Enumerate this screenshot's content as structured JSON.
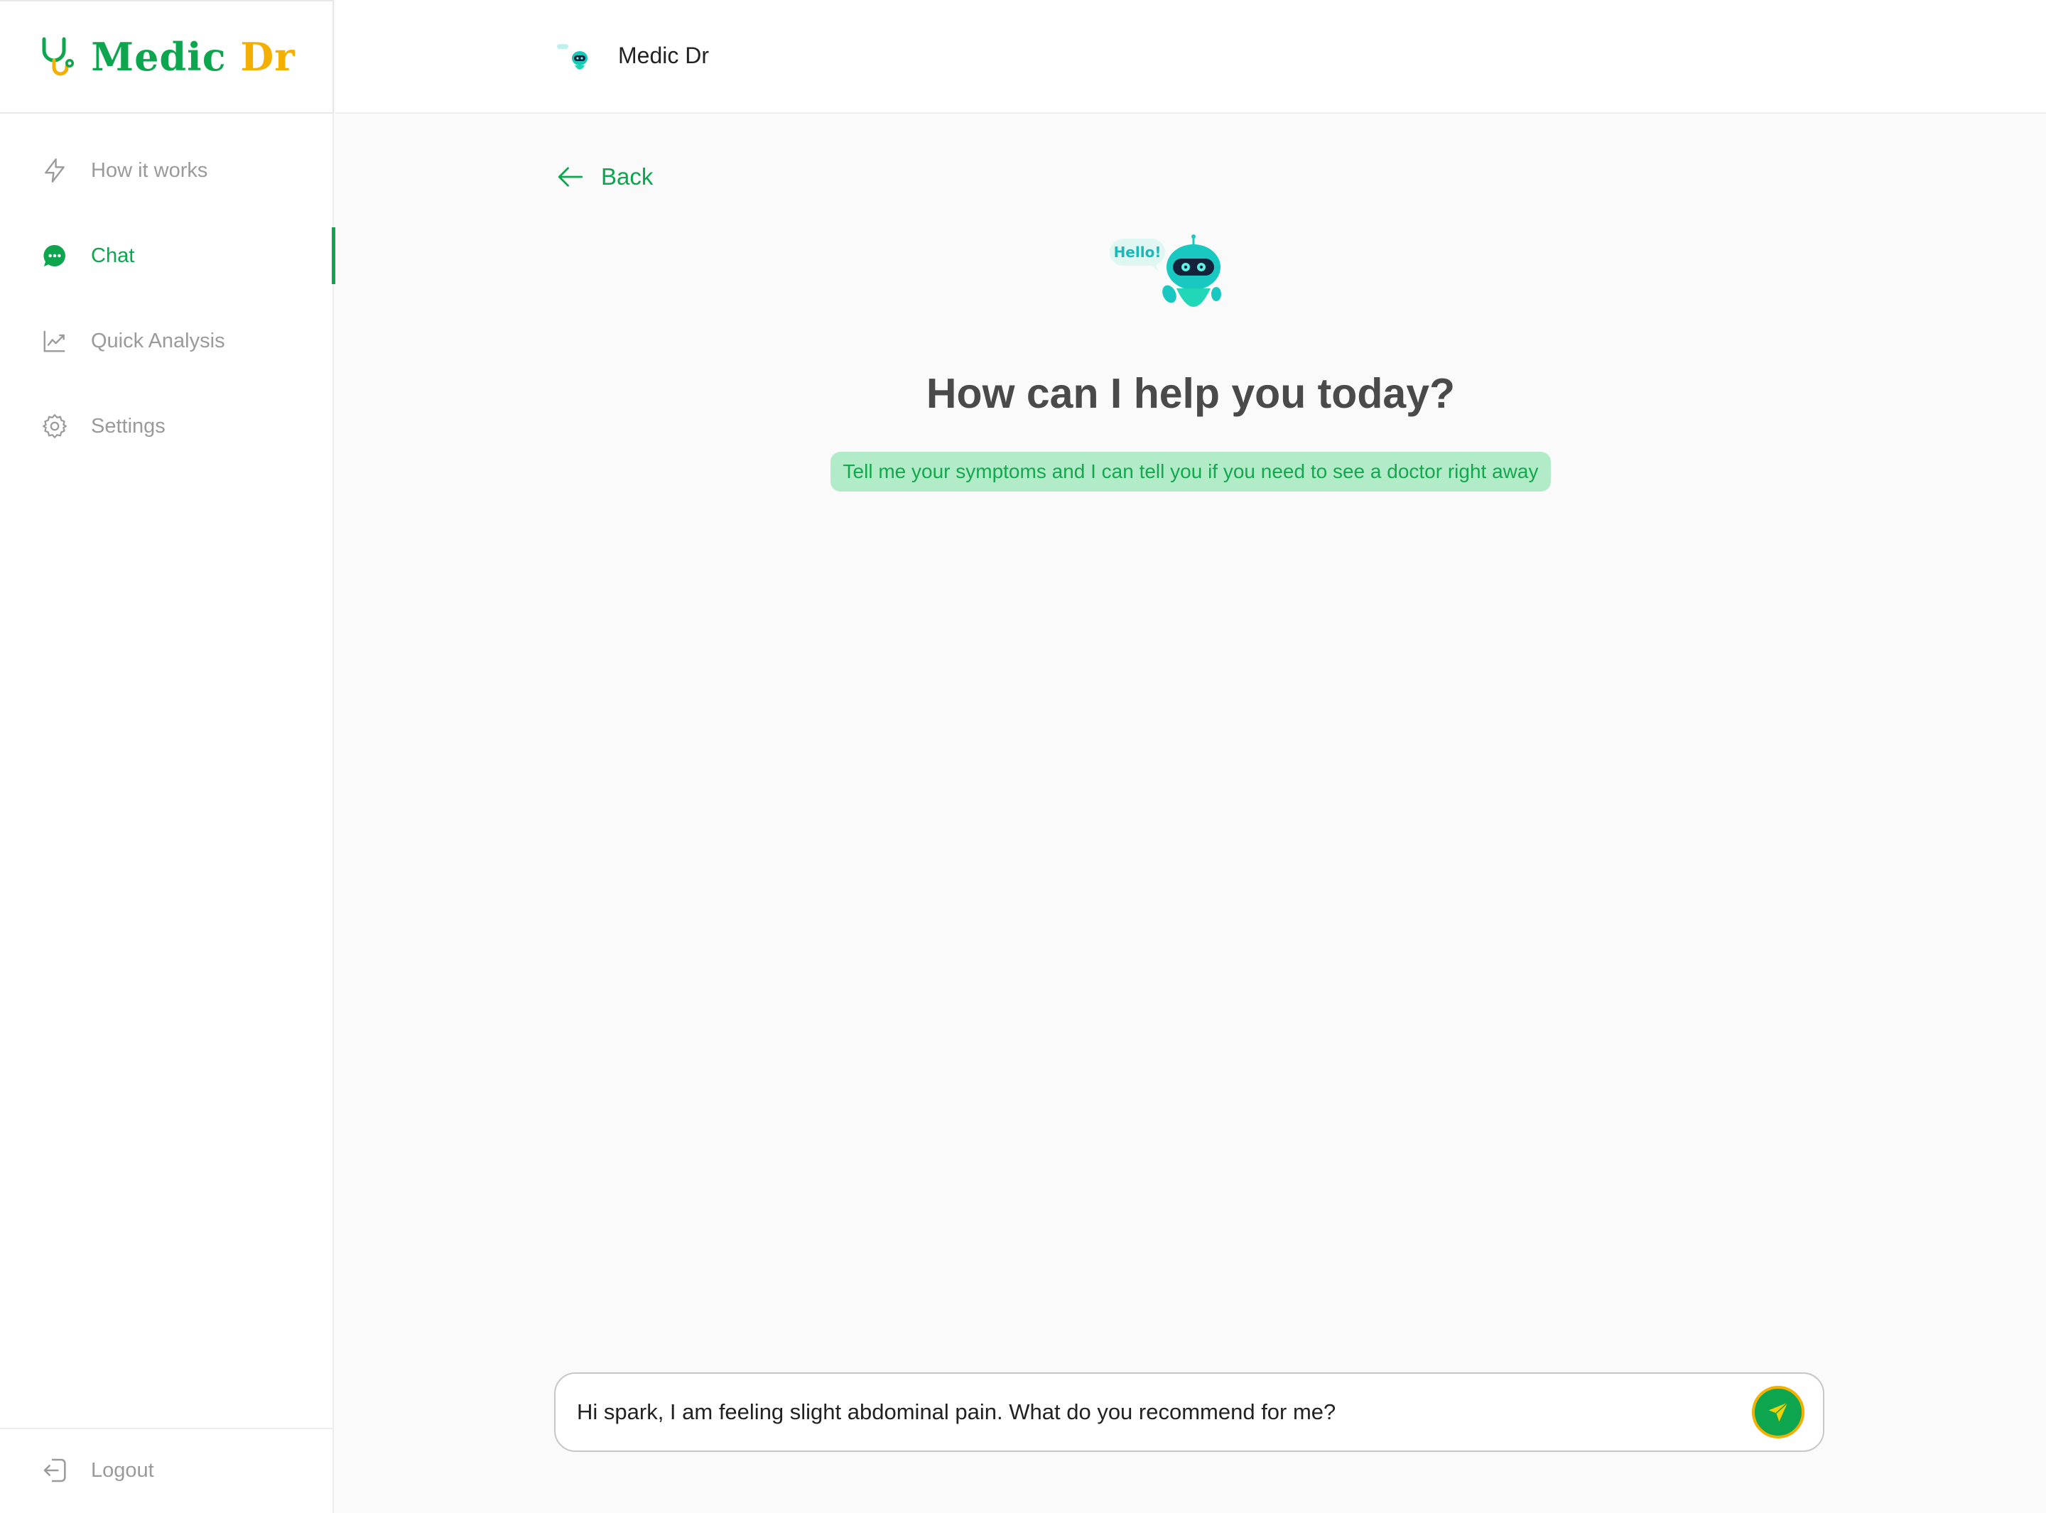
{
  "brand": {
    "name_part1": "Medic",
    "name_part2": "Dr",
    "primary_color": "#0ea54f",
    "accent_color": "#f4b000"
  },
  "sidebar": {
    "items": [
      {
        "label": "How it works",
        "icon": "lightning-icon",
        "active": false
      },
      {
        "label": "Chat",
        "icon": "chat-bubble-icon",
        "active": true
      },
      {
        "label": "Quick Analysis",
        "icon": "line-chart-icon",
        "active": false
      },
      {
        "label": "Settings",
        "icon": "gear-icon",
        "active": false
      }
    ],
    "logout_label": "Logout"
  },
  "header": {
    "title": "Medic Dr",
    "avatar_icon": "robot-avatar-icon"
  },
  "main": {
    "back_label": "Back",
    "bot_bubble_text": "Hello!",
    "headline": "How can I help you today?",
    "hint": "Tell me your symptoms and I can tell you if you need to see a doctor right away"
  },
  "composer": {
    "value": "Hi spark, I am feeling slight abdominal pain. What do you recommend for me?",
    "send_icon": "paper-plane-icon"
  }
}
